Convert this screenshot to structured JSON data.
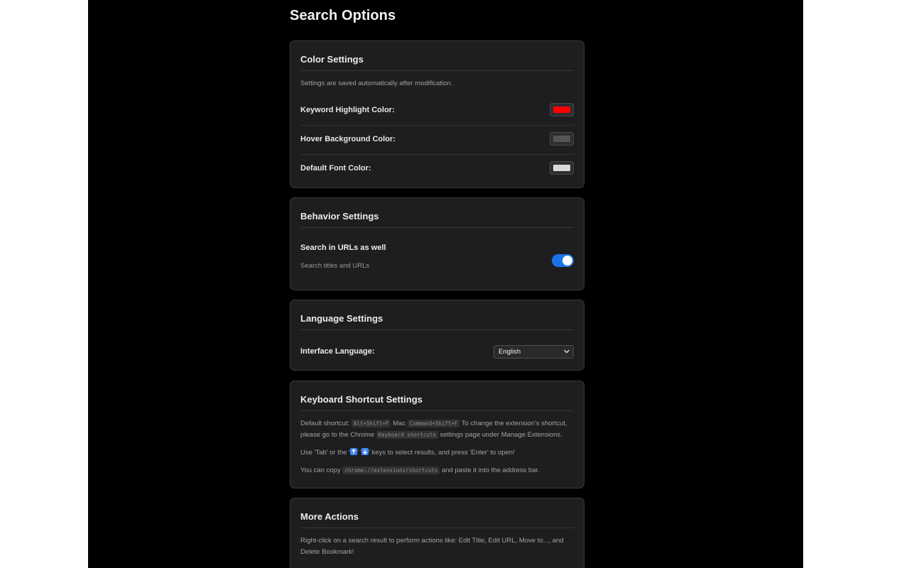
{
  "page": {
    "title": "Search Options"
  },
  "color_settings": {
    "title": "Color Settings",
    "note": "Settings are saved automatically after modification.",
    "rows": [
      {
        "label": "Keyword Highlight Color:",
        "color": "#ff0000"
      },
      {
        "label": "Hover Background Color:",
        "color": "#555555"
      },
      {
        "label": "Default Font Color:",
        "color": "#d9d9d9"
      }
    ]
  },
  "behavior_settings": {
    "title": "Behavior Settings",
    "search_urls_label": "Search in URLs as well",
    "search_urls_desc": "Search titles and URLs",
    "search_urls_enabled": true
  },
  "language_settings": {
    "title": "Language Settings",
    "label": "Interface Language:",
    "selected": "English"
  },
  "shortcut_settings": {
    "title": "Keyboard Shortcut Settings",
    "p1_prefix": "Default shortcut:",
    "p1_win_key": "Alt+Shift+F",
    "p1_mac": "Mac",
    "p1_mac_key": "Command+Shift+F",
    "p1_mid": "To change the extension's shortcut, please go to the Chrome",
    "p1_code2": "Keyboard shortcuts",
    "p1_suffix": "settings page under Manage Extensions.",
    "p2_prefix": "Use 'Tab' or the '",
    "p2_sep": "' '",
    "p2_suffix": "' keys to select results, and press 'Enter' to open!",
    "p3_prefix": "You can copy",
    "p3_code": "chrome://extensions/shortcuts",
    "p3_suffix": "and paste it into the address bar."
  },
  "more_actions": {
    "title": "More Actions",
    "text": "Right-click on a search result to perform actions like: Edit Title, Edit URL, Move to..., and Delete Bookmark!"
  },
  "icons": {
    "up": "arrow-up-icon",
    "down": "arrow-down-icon",
    "chevron": "chevron-down-icon"
  },
  "colors": {
    "toggle_on": "#1a73e8",
    "key_icon": "#3b82f6"
  }
}
